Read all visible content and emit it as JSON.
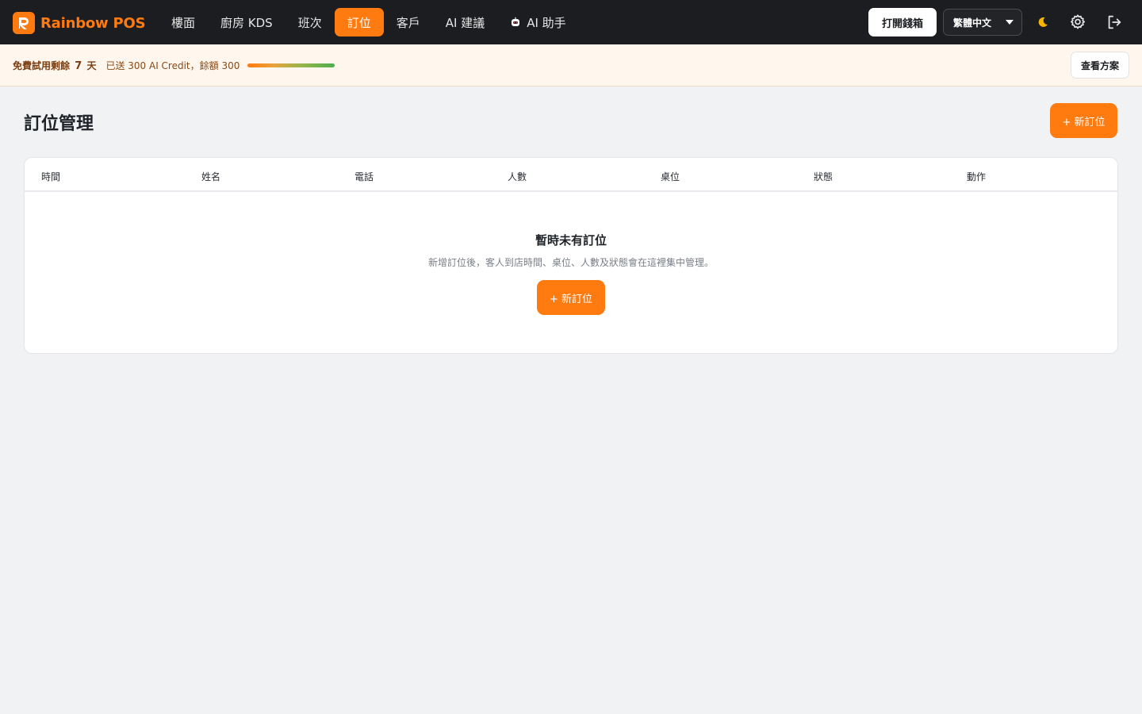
{
  "app": {
    "name": "Rainbow POS",
    "logo_letter": "R",
    "brand_color": "#ff7a0f"
  },
  "nav": {
    "items": [
      {
        "label": "樓面",
        "active": false
      },
      {
        "label": "廚房 KDS",
        "active": false
      },
      {
        "label": "班次",
        "active": false
      },
      {
        "label": "訂位",
        "active": true
      },
      {
        "label": "客戶",
        "active": false
      },
      {
        "label": "AI 建議",
        "active": false
      },
      {
        "label": "AI 助手",
        "active": false,
        "icon": "robot-icon"
      }
    ]
  },
  "topbar": {
    "open_drawer_label": "打開錢箱",
    "language": "繁體中文",
    "icons": [
      "moon-icon",
      "gear-icon",
      "logout-icon"
    ]
  },
  "trial": {
    "prefix": "免費試用剩餘",
    "days": "7",
    "suffix": "天",
    "credit_text": "已送 300 AI Credit，餘額 300",
    "credit_remaining_fraction": 1.0,
    "plans_label": "查看方案"
  },
  "page": {
    "title": "訂位管理",
    "new_button_label": "+ 新訂位"
  },
  "table": {
    "columns": [
      "時間",
      "姓名",
      "電話",
      "人數",
      "桌位",
      "狀態",
      "動作"
    ],
    "rows": []
  },
  "empty_state": {
    "title": "暫時未有訂位",
    "description": "新增訂位後，客人到店時間、桌位、人數及狀態會在這裡集中管理。",
    "button_label": "+ 新訂位"
  }
}
